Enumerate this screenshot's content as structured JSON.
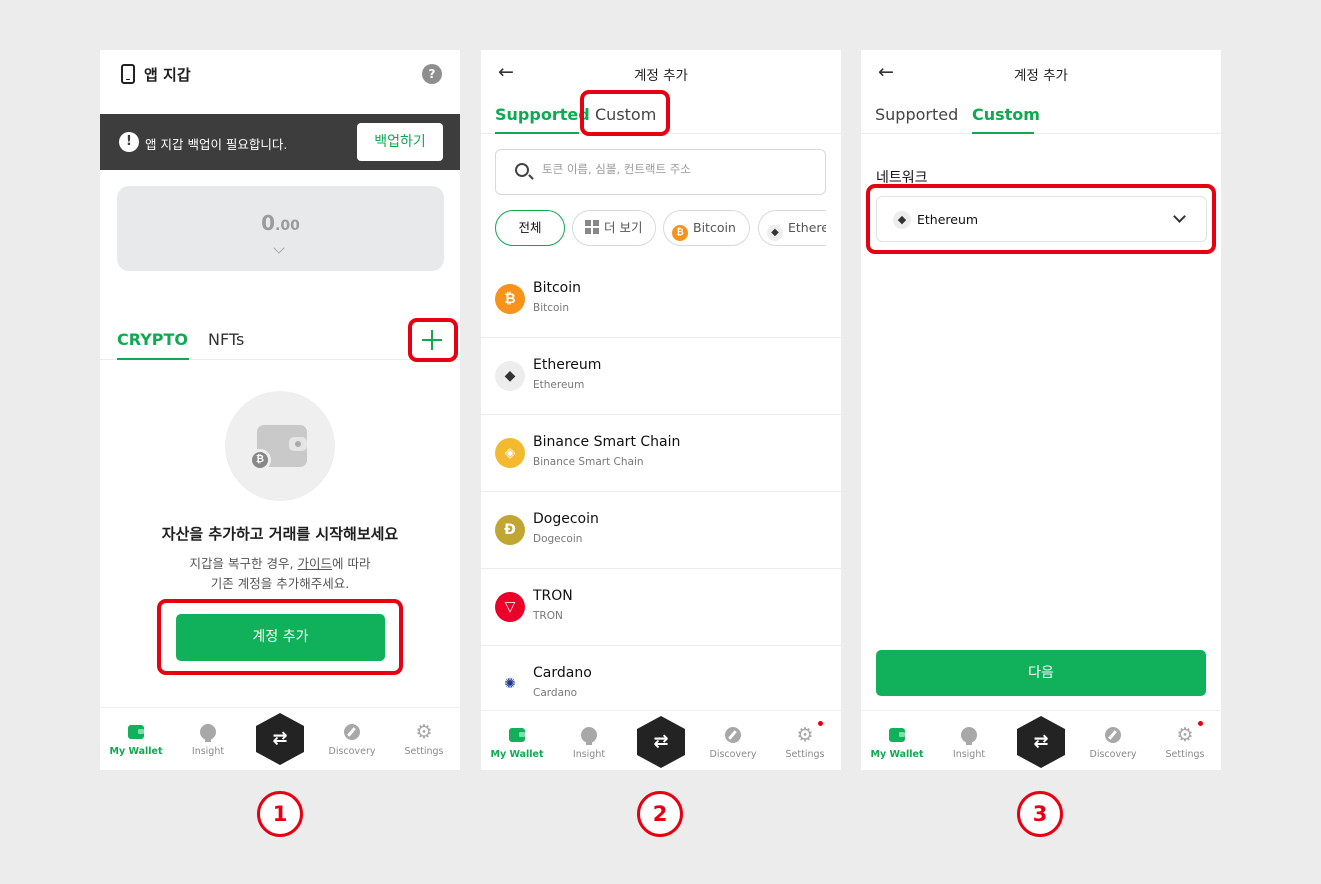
{
  "screen1": {
    "title": "앱 지갑",
    "help": "?",
    "backup": {
      "message": "앱 지갑 백업이 필요합니다.",
      "button": "백업하기",
      "warn": "!"
    },
    "balance": {
      "whole": "0",
      "fraction": ".00"
    },
    "tabs": {
      "crypto": "CRYPTO",
      "nfts": "NFTs"
    },
    "empty": {
      "title": "자산을 추가하고 거래를 시작해보세요",
      "desc_before": "지갑을 복구한 경우, ",
      "desc_link": "가이드",
      "desc_after": "에 따라",
      "desc_line2": "기존 계정을 추가해주세요.",
      "coin": "₿"
    },
    "add_account_button": "계정 추가"
  },
  "screen2": {
    "title": "계정 추가",
    "back": "←",
    "tabs": {
      "supported": "Supported",
      "custom": "Custom"
    },
    "search_placeholder": "토큰 이름, 심볼, 컨트랙트 주소",
    "chips": {
      "all": "전체",
      "more": "더 보기",
      "bitcoin": "Bitcoin",
      "ethereum": "Ethereum",
      "bitcoin_glyph": "₿",
      "eth_glyph": "◆"
    },
    "tokens": [
      {
        "name": "Bitcoin",
        "network": "Bitcoin",
        "glyph": "₿",
        "color": "#f7931a"
      },
      {
        "name": "Ethereum",
        "network": "Ethereum",
        "glyph": "◆",
        "color": "#ededed"
      },
      {
        "name": "Binance Smart Chain",
        "network": "Binance Smart Chain",
        "glyph": "◈",
        "color": "#f3ba2f"
      },
      {
        "name": "Dogecoin",
        "network": "Dogecoin",
        "glyph": "Ð",
        "color": "#c2a633"
      },
      {
        "name": "TRON",
        "network": "TRON",
        "glyph": "▽",
        "color": "#eb0029"
      },
      {
        "name": "Cardano",
        "network": "Cardano",
        "glyph": "✺",
        "color": "#ffffff"
      }
    ]
  },
  "screen3": {
    "title": "계정 추가",
    "back": "←",
    "tabs": {
      "supported": "Supported",
      "custom": "Custom"
    },
    "network_label": "네트워크",
    "network_value": "Ethereum",
    "network_glyph": "◆",
    "next_button": "다음"
  },
  "nav": {
    "wallet": "My Wallet",
    "insight": "Insight",
    "discovery": "Discovery",
    "settings": "Settings",
    "swap": "⇄",
    "gear": "⚙"
  },
  "steps": [
    "1",
    "2",
    "3"
  ],
  "colors": {
    "accent": "#10a952",
    "button": "#10b15a",
    "highlight": "#e60012"
  }
}
